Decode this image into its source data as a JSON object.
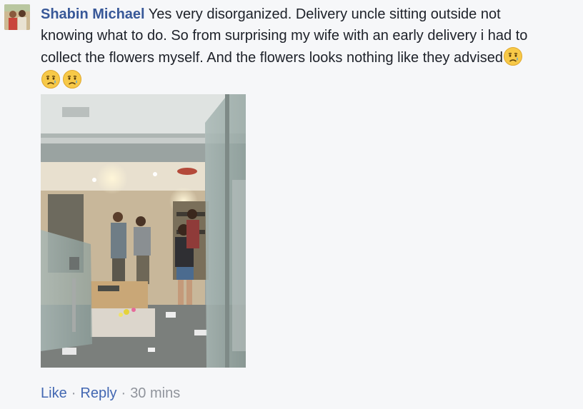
{
  "comment": {
    "author": "Shabin Michael",
    "text": "Yes very disorganized. Delivery uncle sitting outside not knowing what to do. So from surprising my wife with an early delivery i had to collect the flowers myself. And the flowers looks nothing like they advised",
    "emojis": [
      "crying-face-emoji",
      "crying-face-emoji",
      "crying-face-emoji"
    ],
    "image_alt_icon": "flower-shop-photo"
  },
  "actions": {
    "like_label": "Like",
    "separator": "·",
    "reply_label": "Reply",
    "timestamp": "30 mins"
  },
  "colors": {
    "author": "#385898",
    "text": "#1d2129",
    "link": "#4267b2",
    "meta": "#90949c",
    "background": "#f6f7f9"
  }
}
